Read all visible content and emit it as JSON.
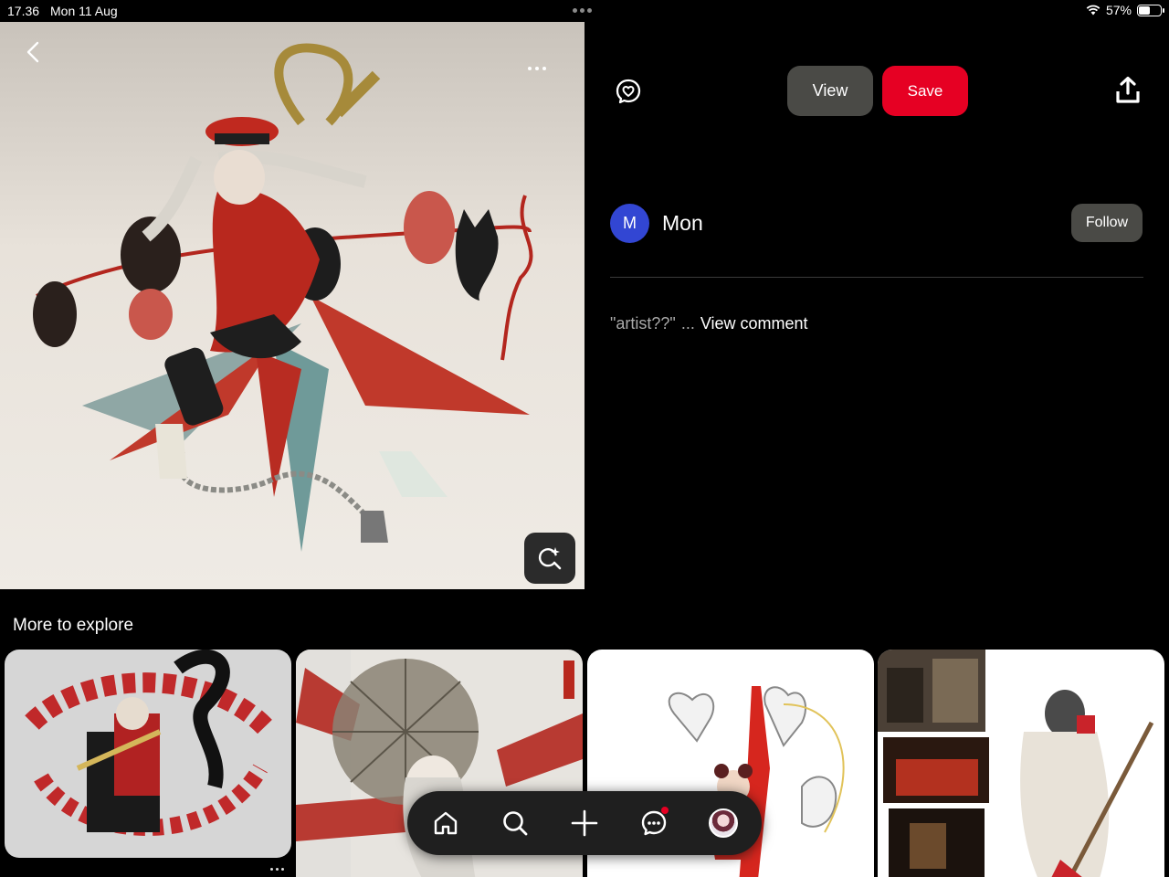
{
  "status_bar": {
    "time": "17.36",
    "date": "Mon 11 Aug",
    "battery_percent": "57%",
    "battery_level": 0.57,
    "icons": [
      "wifi-icon",
      "battery-icon"
    ]
  },
  "pin": {
    "icons": [
      "back-icon",
      "more-icon",
      "visual-search-icon"
    ]
  },
  "actions": {
    "view_label": "View",
    "save_label": "Save",
    "icons": [
      "reaction-icon",
      "share-icon"
    ],
    "save_color": "#e60023"
  },
  "creator": {
    "avatar_initial": "M",
    "name": "Mon",
    "follow_label": "Follow",
    "avatar_color": "#3246d3"
  },
  "comment": {
    "preview": "\"artist??\"",
    "ellipsis": "...",
    "view_label": "View comment"
  },
  "explore": {
    "title": "More to explore"
  },
  "bottom_nav": {
    "items": [
      "home-icon",
      "search-icon",
      "create-icon",
      "messages-icon",
      "profile-avatar"
    ],
    "notification_color": "#e60023"
  }
}
